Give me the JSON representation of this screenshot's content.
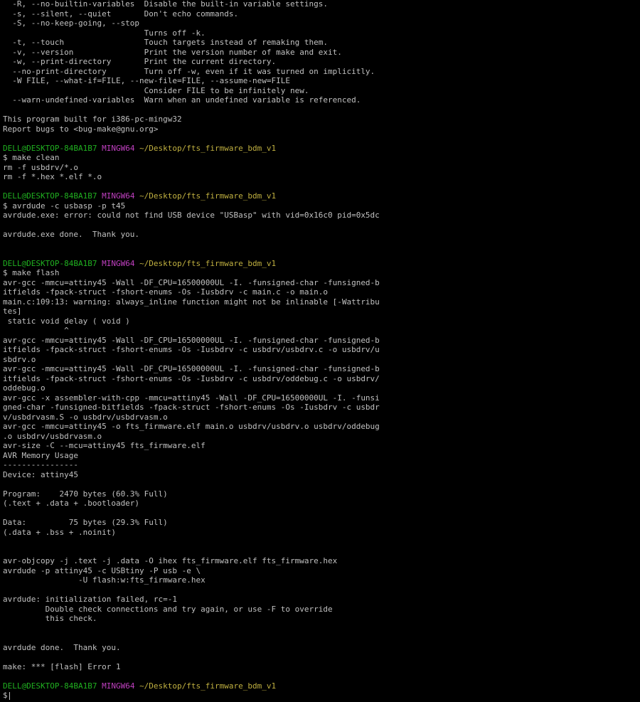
{
  "colors": {
    "background": "#000000",
    "text": "#c0c0c0",
    "prompt_user": "#20b020",
    "prompt_host": "#c040c0",
    "prompt_path": "#c0b040"
  },
  "prompt": {
    "user": "DELL@DESKTOP-84BA1B7",
    "host": "MINGW64",
    "path": "~/Desktop/fts_firmware_bdm_v1"
  },
  "lines": [
    {
      "t": "text",
      "text": "  -R, --no-builtin-variables  Disable the built-in variable settings."
    },
    {
      "t": "text",
      "text": "  -s, --silent, --quiet       Don't echo commands."
    },
    {
      "t": "text",
      "text": "  -S, --no-keep-going, --stop"
    },
    {
      "t": "text",
      "text": "                              Turns off -k."
    },
    {
      "t": "text",
      "text": "  -t, --touch                 Touch targets instead of remaking them."
    },
    {
      "t": "text",
      "text": "  -v, --version               Print the version number of make and exit."
    },
    {
      "t": "text",
      "text": "  -w, --print-directory       Print the current directory."
    },
    {
      "t": "text",
      "text": "  --no-print-directory        Turn off -w, even if it was turned on implicitly."
    },
    {
      "t": "text",
      "text": "  -W FILE, --what-if=FILE, --new-file=FILE, --assume-new=FILE"
    },
    {
      "t": "text",
      "text": "                              Consider FILE to be infinitely new."
    },
    {
      "t": "text",
      "text": "  --warn-undefined-variables  Warn when an undefined variable is referenced."
    },
    {
      "t": "text",
      "text": ""
    },
    {
      "t": "text",
      "text": "This program built for i386-pc-mingw32"
    },
    {
      "t": "text",
      "text": "Report bugs to <bug-make@gnu.org>"
    },
    {
      "t": "text",
      "text": ""
    },
    {
      "t": "prompt"
    },
    {
      "t": "text",
      "text": "$ make clean"
    },
    {
      "t": "text",
      "text": "rm -f usbdrv/*.o"
    },
    {
      "t": "text",
      "text": "rm -f *.hex *.elf *.o"
    },
    {
      "t": "text",
      "text": ""
    },
    {
      "t": "prompt"
    },
    {
      "t": "text",
      "text": "$ avrdude -c usbasp -p t45"
    },
    {
      "t": "text",
      "text": "avrdude.exe: error: could not find USB device \"USBasp\" with vid=0x16c0 pid=0x5dc"
    },
    {
      "t": "text",
      "text": ""
    },
    {
      "t": "text",
      "text": "avrdude.exe done.  Thank you."
    },
    {
      "t": "text",
      "text": ""
    },
    {
      "t": "text",
      "text": ""
    },
    {
      "t": "prompt"
    },
    {
      "t": "text",
      "text": "$ make flash"
    },
    {
      "t": "text",
      "text": "avr-gcc -mmcu=attiny45 -Wall -DF_CPU=16500000UL -I. -funsigned-char -funsigned-b"
    },
    {
      "t": "text",
      "text": "itfields -fpack-struct -fshort-enums -Os -Iusbdrv -c main.c -o main.o"
    },
    {
      "t": "text",
      "text": "main.c:109:13: warning: always_inline function might not be inlinable [-Wattribu"
    },
    {
      "t": "text",
      "text": "tes]"
    },
    {
      "t": "text",
      "text": " static void delay ( void )"
    },
    {
      "t": "text",
      "text": "             ^"
    },
    {
      "t": "text",
      "text": "avr-gcc -mmcu=attiny45 -Wall -DF_CPU=16500000UL -I. -funsigned-char -funsigned-b"
    },
    {
      "t": "text",
      "text": "itfields -fpack-struct -fshort-enums -Os -Iusbdrv -c usbdrv/usbdrv.c -o usbdrv/u"
    },
    {
      "t": "text",
      "text": "sbdrv.o"
    },
    {
      "t": "text",
      "text": "avr-gcc -mmcu=attiny45 -Wall -DF_CPU=16500000UL -I. -funsigned-char -funsigned-b"
    },
    {
      "t": "text",
      "text": "itfields -fpack-struct -fshort-enums -Os -Iusbdrv -c usbdrv/oddebug.c -o usbdrv/"
    },
    {
      "t": "text",
      "text": "oddebug.o"
    },
    {
      "t": "text",
      "text": "avr-gcc -x assembler-with-cpp -mmcu=attiny45 -Wall -DF_CPU=16500000UL -I. -funsi"
    },
    {
      "t": "text",
      "text": "gned-char -funsigned-bitfields -fpack-struct -fshort-enums -Os -Iusbdrv -c usbdr"
    },
    {
      "t": "text",
      "text": "v/usbdrvasm.S -o usbdrv/usbdrvasm.o"
    },
    {
      "t": "text",
      "text": "avr-gcc -mmcu=attiny45 -o fts_firmware.elf main.o usbdrv/usbdrv.o usbdrv/oddebug"
    },
    {
      "t": "text",
      "text": ".o usbdrv/usbdrvasm.o"
    },
    {
      "t": "text",
      "text": "avr-size -C --mcu=attiny45 fts_firmware.elf"
    },
    {
      "t": "text",
      "text": "AVR Memory Usage"
    },
    {
      "t": "text",
      "text": "----------------"
    },
    {
      "t": "text",
      "text": "Device: attiny45"
    },
    {
      "t": "text",
      "text": ""
    },
    {
      "t": "text",
      "text": "Program:    2470 bytes (60.3% Full)"
    },
    {
      "t": "text",
      "text": "(.text + .data + .bootloader)"
    },
    {
      "t": "text",
      "text": ""
    },
    {
      "t": "text",
      "text": "Data:         75 bytes (29.3% Full)"
    },
    {
      "t": "text",
      "text": "(.data + .bss + .noinit)"
    },
    {
      "t": "text",
      "text": ""
    },
    {
      "t": "text",
      "text": ""
    },
    {
      "t": "text",
      "text": "avr-objcopy -j .text -j .data -O ihex fts_firmware.elf fts_firmware.hex"
    },
    {
      "t": "text",
      "text": "avrdude -p attiny45 -c USBtiny -P usb -e \\"
    },
    {
      "t": "text",
      "text": "                -U flash:w:fts_firmware.hex"
    },
    {
      "t": "text",
      "text": ""
    },
    {
      "t": "text",
      "text": "avrdude: initialization failed, rc=-1"
    },
    {
      "t": "text",
      "text": "         Double check connections and try again, or use -F to override"
    },
    {
      "t": "text",
      "text": "         this check."
    },
    {
      "t": "text",
      "text": ""
    },
    {
      "t": "text",
      "text": ""
    },
    {
      "t": "text",
      "text": "avrdude done.  Thank you."
    },
    {
      "t": "text",
      "text": ""
    },
    {
      "t": "text",
      "text": "make: *** [flash] Error 1"
    },
    {
      "t": "text",
      "text": ""
    },
    {
      "t": "prompt"
    },
    {
      "t": "input",
      "text": "$"
    }
  ]
}
